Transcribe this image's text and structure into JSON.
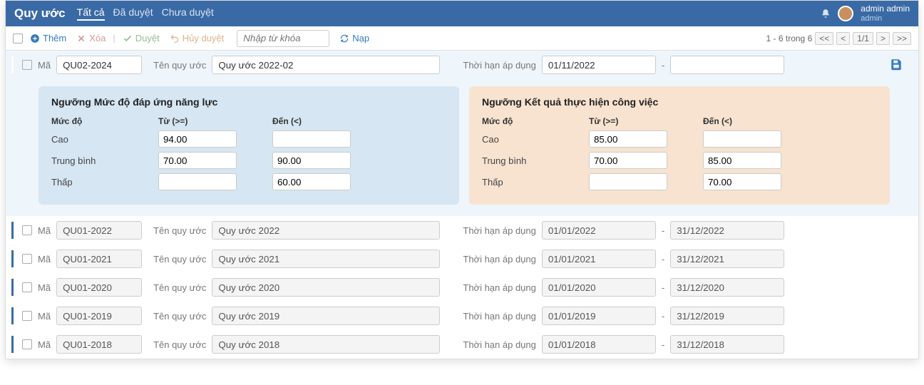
{
  "header": {
    "title": "Quy ước",
    "tabs": [
      "Tất cả",
      "Đã duyệt",
      "Chưa duyệt"
    ],
    "user_name": "admin admin",
    "user_role": "admin"
  },
  "toolbar": {
    "add": "Thêm",
    "del": "Xóa",
    "approve": "Duyệt",
    "unapprove": "Hủy duyệt",
    "search_placeholder": "Nhập từ khóa",
    "reload": "Nạp",
    "page_count": "1 - 6 trong 6",
    "page_current": "1/1"
  },
  "labels": {
    "ma": "Mã",
    "ten": "Tên quy ước",
    "han": "Thời hạn áp dụng"
  },
  "panel1": {
    "title": "Ngưỡng Mức độ đáp ứng năng lực",
    "h1": "Mức độ",
    "h2": "Từ (>=)",
    "h3": "Đến (<)",
    "r1": "Cao",
    "r1f": "94.00",
    "r1t": "",
    "r2": "Trung bình",
    "r2f": "70.00",
    "r2t": "90.00",
    "r3": "Thấp",
    "r3f": "",
    "r3t": "60.00"
  },
  "panel2": {
    "title": "Ngưỡng Kết quả thực hiện công việc",
    "h1": "Mức độ",
    "h2": "Từ (>=)",
    "h3": "Đến (<)",
    "r1": "Cao",
    "r1f": "85.00",
    "r1t": "",
    "r2": "Trung bình",
    "r2f": "70.00",
    "r2t": "85.00",
    "r3": "Thấp",
    "r3f": "",
    "r3t": "70.00"
  },
  "rows": [
    {
      "ma": "QU02-2024",
      "ten": "Quy ước 2022-02",
      "d1": "01/11/2022",
      "d2": "",
      "active": true
    },
    {
      "ma": "QU01-2022",
      "ten": "Quy ước 2022",
      "d1": "01/01/2022",
      "d2": "31/12/2022"
    },
    {
      "ma": "QU01-2021",
      "ten": "Quy ước 2021",
      "d1": "01/01/2021",
      "d2": "31/12/2021"
    },
    {
      "ma": "QU01-2020",
      "ten": "Quy ước 2020",
      "d1": "01/01/2020",
      "d2": "31/12/2020"
    },
    {
      "ma": "QU01-2019",
      "ten": "Quy ước 2019",
      "d1": "01/01/2019",
      "d2": "31/12/2019"
    },
    {
      "ma": "QU01-2018",
      "ten": "Quy ước 2018",
      "d1": "01/01/2018",
      "d2": "31/12/2018"
    }
  ]
}
